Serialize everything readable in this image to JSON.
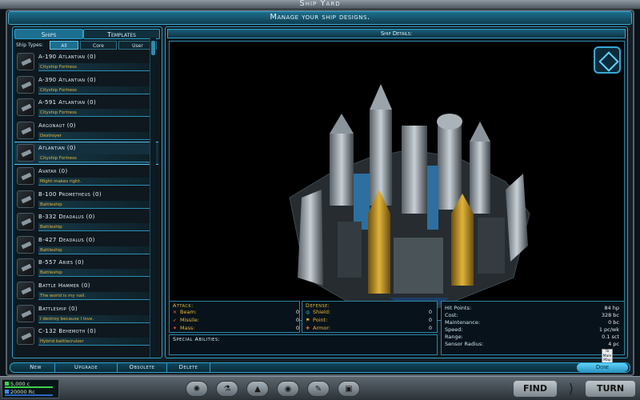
{
  "window": {
    "title": "Ship Yard"
  },
  "header": {
    "text": "Manage your ship designs."
  },
  "left_panel": {
    "tabs": [
      {
        "label": "Ships"
      },
      {
        "label": "Templates"
      }
    ],
    "filter": {
      "label": "Ship Types:",
      "options": [
        {
          "label": "All"
        },
        {
          "label": "Core"
        },
        {
          "label": "User"
        }
      ],
      "selected": "All"
    },
    "ships": [
      {
        "name": "A-190 Atlantian (0)",
        "desc": "Cityship Fortress"
      },
      {
        "name": "A-390 Atlantian (0)",
        "desc": "Cityship Fortress"
      },
      {
        "name": "A-591 Atlantian (0)",
        "desc": "Cityship Fortress"
      },
      {
        "name": "Argonaut (0)",
        "desc": "Destroyer"
      },
      {
        "name": "Atlantian (0)",
        "desc": "Cityship Fortress"
      },
      {
        "name": "Avatar (0)",
        "desc": "Might makes right."
      },
      {
        "name": "B-100 Prometheus (0)",
        "desc": "Battleship"
      },
      {
        "name": "B-332 Deadalus (0)",
        "desc": "Battleship"
      },
      {
        "name": "B-427 Deadalus (0)",
        "desc": "Battleship"
      },
      {
        "name": "B-557 Aries (0)",
        "desc": "Battleship"
      },
      {
        "name": "Battle Hammer (0)",
        "desc": "The world is my nail."
      },
      {
        "name": "Battleship (0)",
        "desc": "I destroy because I love."
      },
      {
        "name": "C-132 Behemoth (0)",
        "desc": "Hybrid battlecruiser"
      }
    ],
    "selected_index": 4
  },
  "details": {
    "header": "Ship Details:",
    "attack": {
      "title": "Attack:",
      "rows": [
        {
          "label": "Beam:",
          "value": "0"
        },
        {
          "label": "Missile:",
          "value": "0"
        },
        {
          "label": "Mass:",
          "value": "0"
        }
      ]
    },
    "defense": {
      "title": "Defense:",
      "rows": [
        {
          "label": "Shield:",
          "value": "0"
        },
        {
          "label": "Point:",
          "value": "0"
        },
        {
          "label": "Armor:",
          "value": "0"
        }
      ]
    },
    "hull": {
      "rows": [
        {
          "label": "Hit Points:",
          "value": "84 hp"
        },
        {
          "label": "Cost:",
          "value": "328 bc"
        },
        {
          "label": "Maintenance:",
          "value": "0 bc"
        },
        {
          "label": "Speed:",
          "value": "1 pc/wk"
        },
        {
          "label": "Range:",
          "value": "0.1 sct"
        },
        {
          "label": "Sensor Radius:",
          "value": "4 pc"
        }
      ]
    },
    "special": {
      "title": "Special Abilities:"
    },
    "to_main_map": "To Main Map"
  },
  "actions": {
    "new": "New",
    "upgrade": "Upgrade",
    "obsolete": "Obsolete",
    "delete": "Delete",
    "done": "Done"
  },
  "hud": {
    "credits_line1": "5,000 c",
    "credits_line2": "20000 Rc",
    "find": "FIND",
    "turn": "TURN"
  },
  "colors": {
    "accent": "#2f9fca",
    "label_gold": "#e8b838",
    "panel_bg": "#0e181e"
  }
}
